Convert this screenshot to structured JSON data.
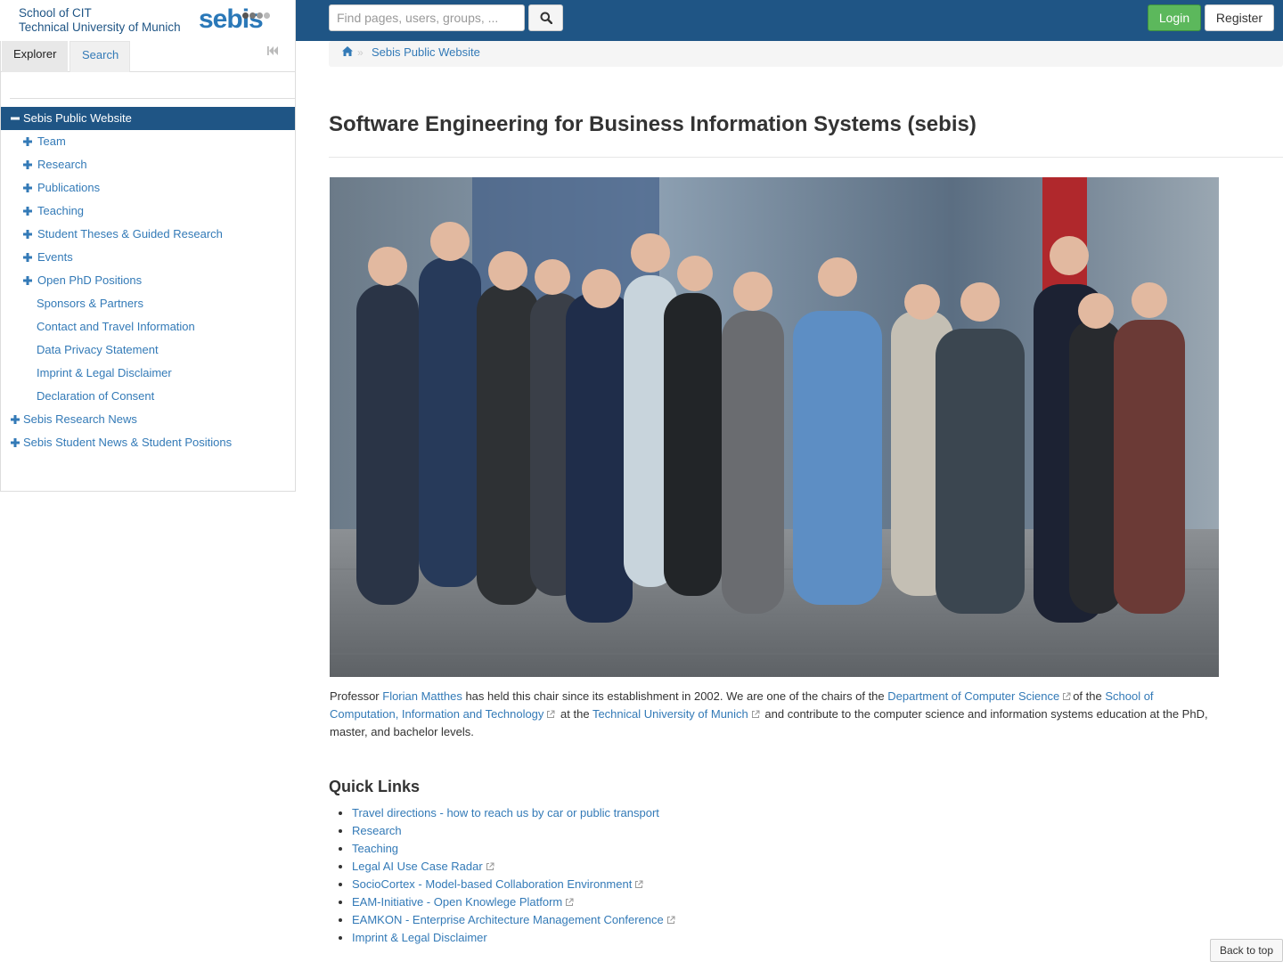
{
  "header": {
    "logo_line1": "School of CIT",
    "logo_line2": "Technical University of Munich",
    "logo_brand": "sebis",
    "search_placeholder": "Find pages, users, groups, ...",
    "search_icon": "search-icon",
    "login_label": "Login",
    "register_label": "Register",
    "colors": {
      "bar": "#1f5585",
      "login": "#5cb85c"
    }
  },
  "sidebar": {
    "tabs": [
      {
        "label": "Explorer"
      },
      {
        "label": "Search"
      }
    ],
    "root": {
      "label": "Sebis Public Website",
      "expanded": true
    },
    "children": [
      {
        "label": "Team",
        "expandable": true
      },
      {
        "label": "Research",
        "expandable": true
      },
      {
        "label": "Publications",
        "expandable": true
      },
      {
        "label": "Teaching",
        "expandable": true
      },
      {
        "label": "Student Theses & Guided Research",
        "expandable": true
      },
      {
        "label": "Events",
        "expandable": true
      },
      {
        "label": "Open PhD Positions",
        "expandable": true
      },
      {
        "label": "Sponsors & Partners",
        "expandable": false
      },
      {
        "label": "Contact and Travel Information",
        "expandable": false
      },
      {
        "label": "Data Privacy Statement",
        "expandable": false
      },
      {
        "label": "Imprint & Legal Disclaimer",
        "expandable": false
      },
      {
        "label": "Declaration of Consent",
        "expandable": false
      }
    ],
    "siblings": [
      {
        "label": "Sebis Research News",
        "expandable": true
      },
      {
        "label": "Sebis Student News & Student Positions",
        "expandable": true
      }
    ]
  },
  "breadcrumb": {
    "home_icon": "home-icon",
    "current": "Sebis Public Website"
  },
  "main": {
    "title": "Software Engineering for Business Information Systems (sebis)",
    "intro": {
      "t1": "Professor ",
      "link_professor": "Florian Matthes",
      "t2": " has held this chair since its establishment in 2002. We are one of the chairs of the ",
      "link_department": "Department of Computer Science",
      "t3": "of the ",
      "link_school": "School of Computation, Information and Technology",
      "t4": " at the ",
      "link_tum": "Technical University of Munich",
      "t5": " and contribute to the computer science and information systems education at the PhD, master, and bachelor levels."
    },
    "quick_links_title": "Quick Links",
    "quick_links": [
      {
        "label": "Travel directions - how to reach us by car or public transport",
        "external": false
      },
      {
        "label": "Research",
        "external": false
      },
      {
        "label": "Teaching",
        "external": false
      },
      {
        "label": "Legal AI Use Case Radar",
        "external": true
      },
      {
        "label": "SocioCortex - Model-based Collaboration Environment",
        "external": true
      },
      {
        "label": "EAM-Initiative - Open Knowlege Platform",
        "external": true
      },
      {
        "label": "EAMKON - Enterprise Architecture Management Conference",
        "external": true
      },
      {
        "label": "Imprint & Legal Disclaimer",
        "external": false
      }
    ]
  },
  "back_to_top_label": "Back to top"
}
